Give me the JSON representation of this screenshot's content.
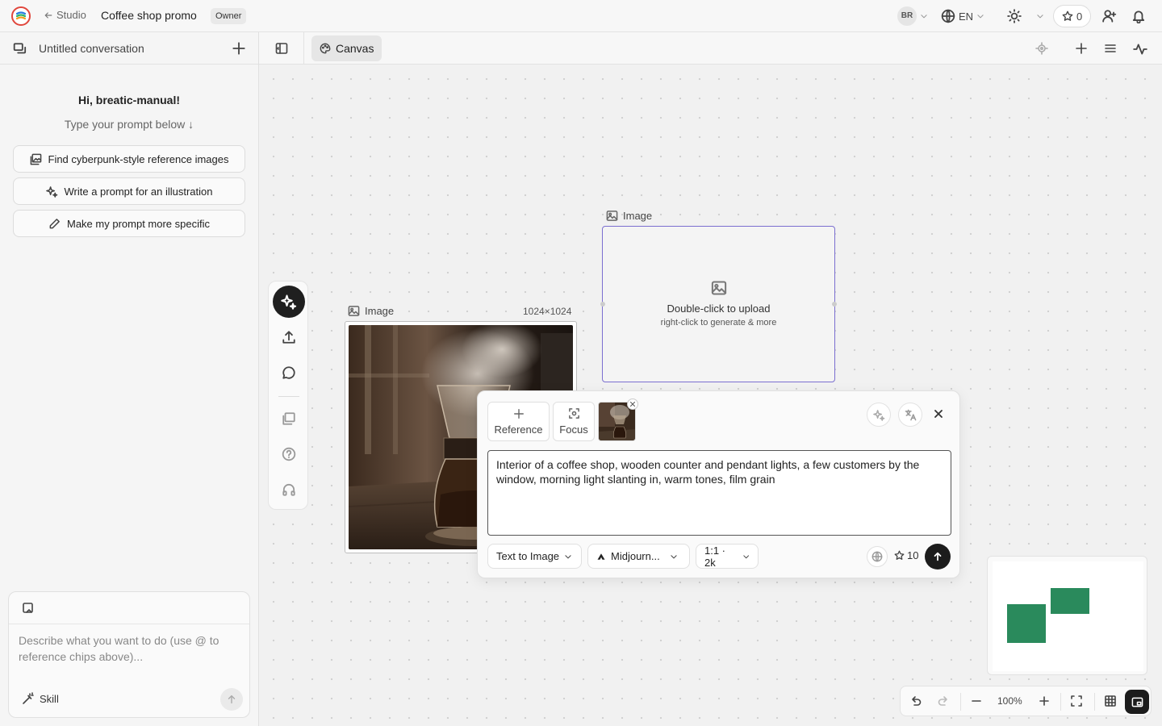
{
  "topbar": {
    "back_label": "Studio",
    "project_title": "Coffee shop promo",
    "role_badge": "Owner",
    "user_initials": "BR",
    "language": "EN",
    "credits": "0"
  },
  "conversation": {
    "title": "Untitled conversation",
    "greeting": "Hi, breatic-manual!",
    "greeting_sub": "Type your prompt below ↓",
    "suggestions": [
      {
        "label": "Find cyberpunk-style reference images",
        "icon": "image-search-icon"
      },
      {
        "label": "Write a prompt for an illustration",
        "icon": "sparkles-icon"
      },
      {
        "label": "Make my prompt more specific",
        "icon": "pencil-icon"
      }
    ],
    "input_placeholder": "Describe what you want to do (use @ to reference chips above)...",
    "skill_label": "Skill"
  },
  "canvas_toolbar": {
    "tab_label": "Canvas"
  },
  "nodes": [
    {
      "label": "Image",
      "size": "1024×1024",
      "content": "coffee pour-over photo"
    },
    {
      "label": "Image",
      "empty_line1": "Double-click to upload",
      "empty_line2": "right-click to generate & more"
    }
  ],
  "prompt_panel": {
    "reference_label": "Reference",
    "focus_label": "Focus",
    "prompt": "Interior of a coffee shop, wooden counter and pendant lights, a few customers by the window, morning light slanting in, warm tones, film grain",
    "mode": "Text to Image",
    "model": "Midjourn...",
    "ratio": "1:1 · 2k",
    "cost": "10"
  },
  "bottom_controls": {
    "zoom": "100%"
  },
  "colors": {
    "accent_selection": "#7b6fd0",
    "minimap_node": "#2a8a5c",
    "primary_dark": "#1c1c1c"
  }
}
